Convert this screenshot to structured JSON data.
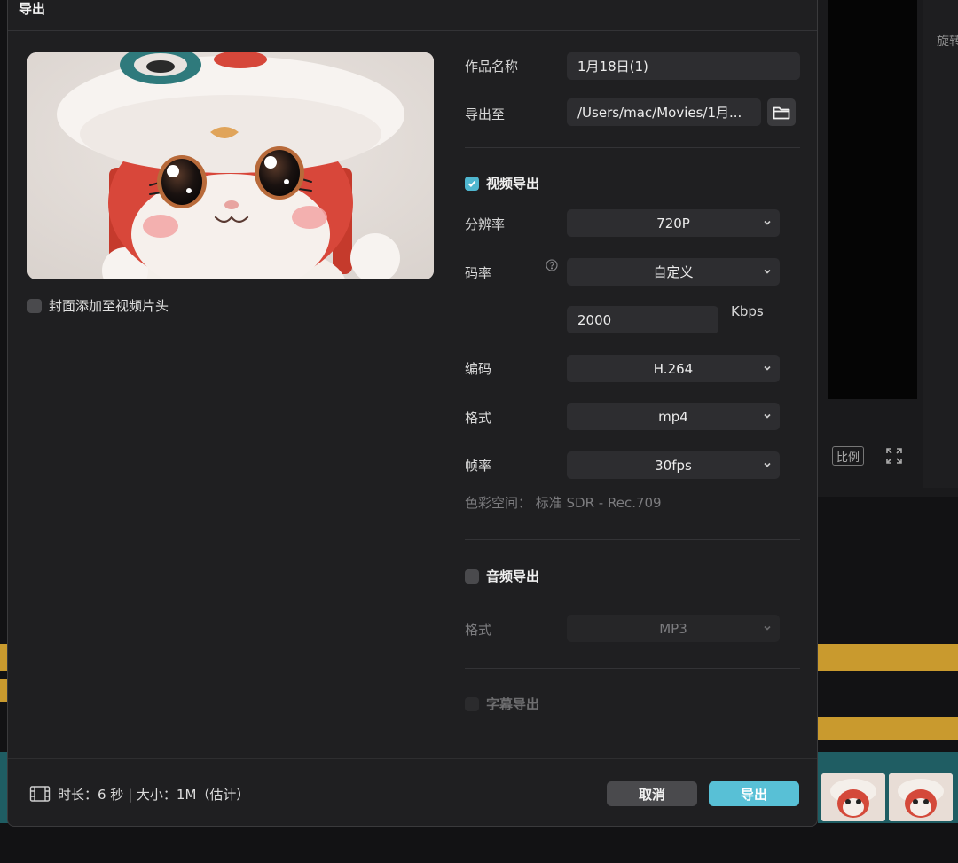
{
  "background": {
    "right_panel_label": "旋转",
    "ratio_button": "比例"
  },
  "dialog": {
    "title": "导出",
    "cover_option": {
      "label": "封面添加至视频片头",
      "checked": false
    },
    "form": {
      "name_label": "作品名称",
      "name_value": "1月18日(1)",
      "export_to_label": "导出至",
      "export_to_value": "/Users/mac/Movies/1月...",
      "video_export": {
        "label": "视频导出",
        "checked": true
      },
      "resolution": {
        "label": "分辨率",
        "value": "720P"
      },
      "bitrate": {
        "label": "码率",
        "value": "自定义"
      },
      "bitrate_custom": {
        "value": "2000",
        "unit": "Kbps"
      },
      "codec": {
        "label": "编码",
        "value": "H.264"
      },
      "format": {
        "label": "格式",
        "value": "mp4"
      },
      "framerate": {
        "label": "帧率",
        "value": "30fps"
      },
      "color_space": "色彩空间：  标准 SDR - Rec.709",
      "audio_export": {
        "label": "音频导出",
        "checked": false
      },
      "audio_format": {
        "label": "格式",
        "value": "MP3"
      },
      "subtitle_export": {
        "label": "字幕导出",
        "checked": false
      }
    },
    "footer": {
      "info": "时长：6 秒 | 大小：1M（估计）",
      "cancel_label": "取消",
      "export_label": "导出"
    }
  },
  "colors": {
    "accent": "#58c0d6",
    "dialog_bg": "#1f1f21",
    "field_bg": "#2d2d30",
    "track_gold": "#c99a2e",
    "track_teal": "#1f5d63"
  }
}
